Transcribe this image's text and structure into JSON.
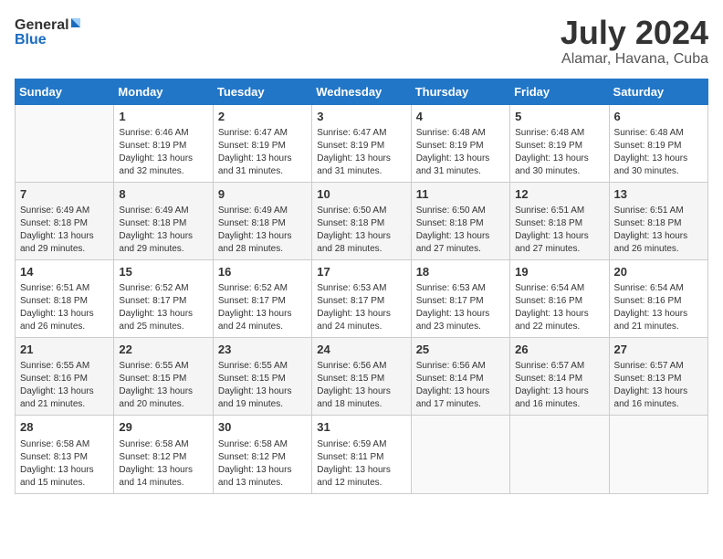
{
  "header": {
    "logo_general": "General",
    "logo_blue": "Blue",
    "month_year": "July 2024",
    "location": "Alamar, Havana, Cuba"
  },
  "days_of_week": [
    "Sunday",
    "Monday",
    "Tuesday",
    "Wednesday",
    "Thursday",
    "Friday",
    "Saturday"
  ],
  "weeks": [
    [
      {
        "day": "",
        "sunrise": "",
        "sunset": "",
        "daylight": ""
      },
      {
        "day": "1",
        "sunrise": "6:46 AM",
        "sunset": "8:19 PM",
        "daylight": "13 hours and 32 minutes."
      },
      {
        "day": "2",
        "sunrise": "6:47 AM",
        "sunset": "8:19 PM",
        "daylight": "13 hours and 31 minutes."
      },
      {
        "day": "3",
        "sunrise": "6:47 AM",
        "sunset": "8:19 PM",
        "daylight": "13 hours and 31 minutes."
      },
      {
        "day": "4",
        "sunrise": "6:48 AM",
        "sunset": "8:19 PM",
        "daylight": "13 hours and 31 minutes."
      },
      {
        "day": "5",
        "sunrise": "6:48 AM",
        "sunset": "8:19 PM",
        "daylight": "13 hours and 30 minutes."
      },
      {
        "day": "6",
        "sunrise": "6:48 AM",
        "sunset": "8:19 PM",
        "daylight": "13 hours and 30 minutes."
      }
    ],
    [
      {
        "day": "7",
        "sunrise": "6:49 AM",
        "sunset": "8:18 PM",
        "daylight": "13 hours and 29 minutes."
      },
      {
        "day": "8",
        "sunrise": "6:49 AM",
        "sunset": "8:18 PM",
        "daylight": "13 hours and 29 minutes."
      },
      {
        "day": "9",
        "sunrise": "6:49 AM",
        "sunset": "8:18 PM",
        "daylight": "13 hours and 28 minutes."
      },
      {
        "day": "10",
        "sunrise": "6:50 AM",
        "sunset": "8:18 PM",
        "daylight": "13 hours and 28 minutes."
      },
      {
        "day": "11",
        "sunrise": "6:50 AM",
        "sunset": "8:18 PM",
        "daylight": "13 hours and 27 minutes."
      },
      {
        "day": "12",
        "sunrise": "6:51 AM",
        "sunset": "8:18 PM",
        "daylight": "13 hours and 27 minutes."
      },
      {
        "day": "13",
        "sunrise": "6:51 AM",
        "sunset": "8:18 PM",
        "daylight": "13 hours and 26 minutes."
      }
    ],
    [
      {
        "day": "14",
        "sunrise": "6:51 AM",
        "sunset": "8:18 PM",
        "daylight": "13 hours and 26 minutes."
      },
      {
        "day": "15",
        "sunrise": "6:52 AM",
        "sunset": "8:17 PM",
        "daylight": "13 hours and 25 minutes."
      },
      {
        "day": "16",
        "sunrise": "6:52 AM",
        "sunset": "8:17 PM",
        "daylight": "13 hours and 24 minutes."
      },
      {
        "day": "17",
        "sunrise": "6:53 AM",
        "sunset": "8:17 PM",
        "daylight": "13 hours and 24 minutes."
      },
      {
        "day": "18",
        "sunrise": "6:53 AM",
        "sunset": "8:17 PM",
        "daylight": "13 hours and 23 minutes."
      },
      {
        "day": "19",
        "sunrise": "6:54 AM",
        "sunset": "8:16 PM",
        "daylight": "13 hours and 22 minutes."
      },
      {
        "day": "20",
        "sunrise": "6:54 AM",
        "sunset": "8:16 PM",
        "daylight": "13 hours and 21 minutes."
      }
    ],
    [
      {
        "day": "21",
        "sunrise": "6:55 AM",
        "sunset": "8:16 PM",
        "daylight": "13 hours and 21 minutes."
      },
      {
        "day": "22",
        "sunrise": "6:55 AM",
        "sunset": "8:15 PM",
        "daylight": "13 hours and 20 minutes."
      },
      {
        "day": "23",
        "sunrise": "6:55 AM",
        "sunset": "8:15 PM",
        "daylight": "13 hours and 19 minutes."
      },
      {
        "day": "24",
        "sunrise": "6:56 AM",
        "sunset": "8:15 PM",
        "daylight": "13 hours and 18 minutes."
      },
      {
        "day": "25",
        "sunrise": "6:56 AM",
        "sunset": "8:14 PM",
        "daylight": "13 hours and 17 minutes."
      },
      {
        "day": "26",
        "sunrise": "6:57 AM",
        "sunset": "8:14 PM",
        "daylight": "13 hours and 16 minutes."
      },
      {
        "day": "27",
        "sunrise": "6:57 AM",
        "sunset": "8:13 PM",
        "daylight": "13 hours and 16 minutes."
      }
    ],
    [
      {
        "day": "28",
        "sunrise": "6:58 AM",
        "sunset": "8:13 PM",
        "daylight": "13 hours and 15 minutes."
      },
      {
        "day": "29",
        "sunrise": "6:58 AM",
        "sunset": "8:12 PM",
        "daylight": "13 hours and 14 minutes."
      },
      {
        "day": "30",
        "sunrise": "6:58 AM",
        "sunset": "8:12 PM",
        "daylight": "13 hours and 13 minutes."
      },
      {
        "day": "31",
        "sunrise": "6:59 AM",
        "sunset": "8:11 PM",
        "daylight": "13 hours and 12 minutes."
      },
      {
        "day": "",
        "sunrise": "",
        "sunset": "",
        "daylight": ""
      },
      {
        "day": "",
        "sunrise": "",
        "sunset": "",
        "daylight": ""
      },
      {
        "day": "",
        "sunrise": "",
        "sunset": "",
        "daylight": ""
      }
    ]
  ],
  "labels": {
    "sunrise_prefix": "Sunrise: ",
    "sunset_prefix": "Sunset: ",
    "daylight_prefix": "Daylight: "
  }
}
